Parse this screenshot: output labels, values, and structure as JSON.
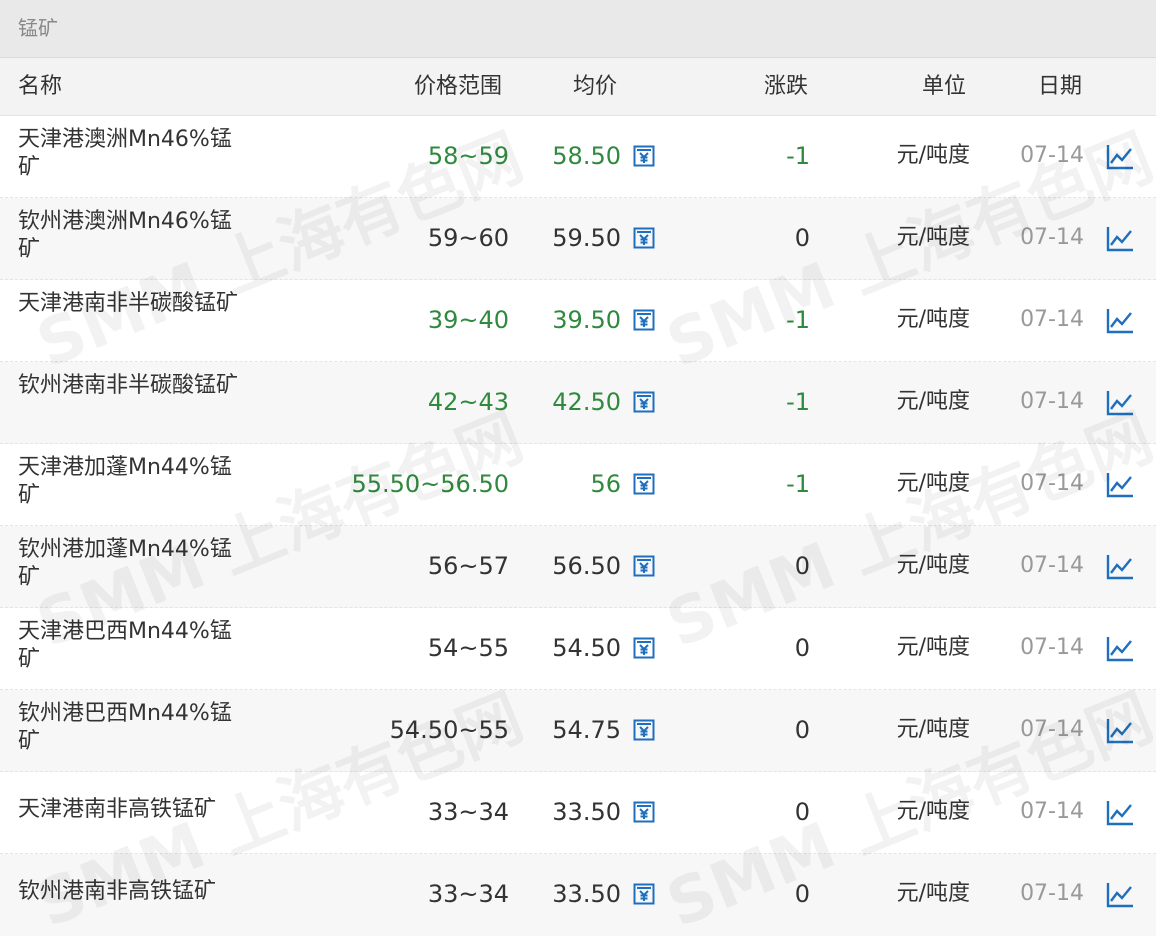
{
  "section": {
    "title": "锰矿"
  },
  "columns": {
    "name": "名称",
    "range": "价格范围",
    "avg": "均价",
    "change": "涨跌",
    "unit": "单位",
    "date": "日期"
  },
  "watermark": "SMM 上海有色网",
  "colors": {
    "down": "#2f8a3d",
    "flat": "#333333",
    "icon": "#1f6fbf"
  },
  "icons": {
    "calculator": "calculator-icon",
    "trend": "trend-chart-icon"
  },
  "rows": [
    {
      "name": "天津港澳洲Mn46%锰矿",
      "range": "58~59",
      "avg": "58.50",
      "change": "-1",
      "unit": "元/吨度",
      "date": "07-14",
      "trend": "down"
    },
    {
      "name": "钦州港澳洲Mn46%锰矿",
      "range": "59~60",
      "avg": "59.50",
      "change": "0",
      "unit": "元/吨度",
      "date": "07-14",
      "trend": "flat"
    },
    {
      "name": "天津港南非半碳酸锰矿",
      "range": "39~40",
      "avg": "39.50",
      "change": "-1",
      "unit": "元/吨度",
      "date": "07-14",
      "trend": "down"
    },
    {
      "name": "钦州港南非半碳酸锰矿",
      "range": "42~43",
      "avg": "42.50",
      "change": "-1",
      "unit": "元/吨度",
      "date": "07-14",
      "trend": "down"
    },
    {
      "name": "天津港加蓬Mn44%锰矿",
      "range": "55.50~56.50",
      "avg": "56",
      "change": "-1",
      "unit": "元/吨度",
      "date": "07-14",
      "trend": "down"
    },
    {
      "name": "钦州港加蓬Mn44%锰矿",
      "range": "56~57",
      "avg": "56.50",
      "change": "0",
      "unit": "元/吨度",
      "date": "07-14",
      "trend": "flat"
    },
    {
      "name": "天津港巴西Mn44%锰矿",
      "range": "54~55",
      "avg": "54.50",
      "change": "0",
      "unit": "元/吨度",
      "date": "07-14",
      "trend": "flat"
    },
    {
      "name": "钦州港巴西Mn44%锰矿",
      "range": "54.50~55",
      "avg": "54.75",
      "change": "0",
      "unit": "元/吨度",
      "date": "07-14",
      "trend": "flat"
    },
    {
      "name": "天津港南非高铁锰矿",
      "range": "33~34",
      "avg": "33.50",
      "change": "0",
      "unit": "元/吨度",
      "date": "07-14",
      "trend": "flat"
    },
    {
      "name": "钦州港南非高铁锰矿",
      "range": "33~34",
      "avg": "33.50",
      "change": "0",
      "unit": "元/吨度",
      "date": "07-14",
      "trend": "flat"
    }
  ]
}
